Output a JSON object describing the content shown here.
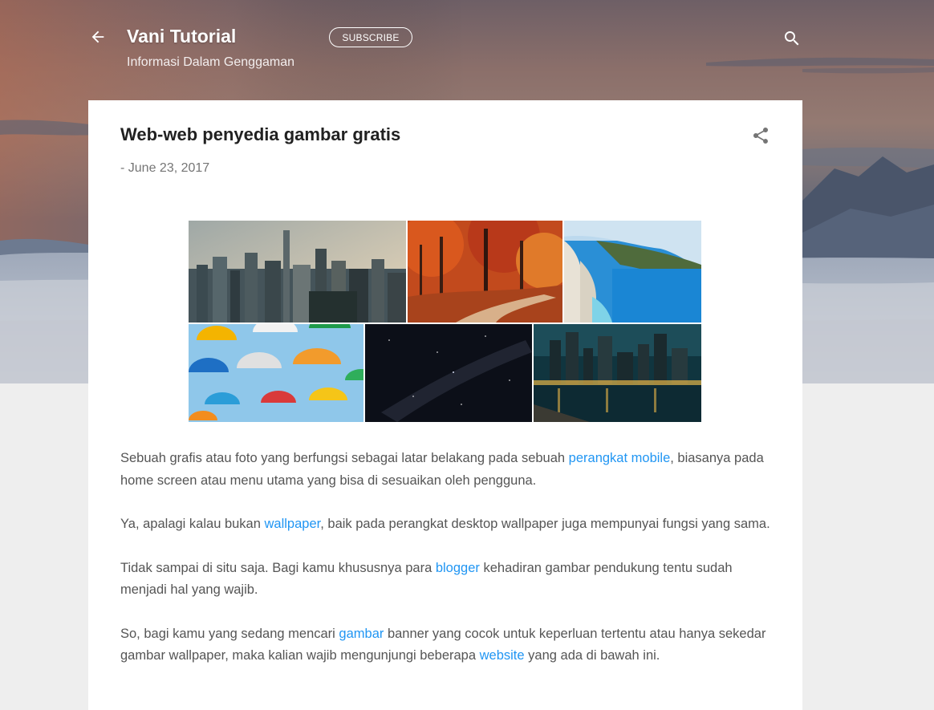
{
  "header": {
    "site_title": "Vani Tutorial",
    "site_description": "Informasi Dalam Genggaman",
    "subscribe_label": "SUBSCRIBE",
    "back_icon": "arrow-left-icon",
    "search_icon": "search-icon"
  },
  "post": {
    "title": "Web-web penyedia gambar gratis",
    "date": "- June 23, 2017",
    "share_icon": "share-icon",
    "paragraphs": [
      {
        "before": "Sebuah grafis atau foto yang berfungsi sebagai latar belakang pada sebuah ",
        "link": "perangkat mobile",
        "after": ", biasanya pada home screen atau menu utama yang bisa di sesuaikan oleh pengguna."
      },
      {
        "before": "Ya, apalagi kalau bukan ",
        "link": "wallpaper",
        "after": ", baik pada perangkat desktop wallpaper juga mempunyai fungsi yang sama."
      },
      {
        "before": "Tidak sampai di situ saja. Bagi kamu khususnya para ",
        "link": "blogger",
        "after": " kehadiran gambar pendukung tentu sudah menjadi hal yang wajib."
      },
      {
        "before": "So, bagi kamu yang sedang mencari ",
        "link": "gambar",
        "middle": " banner yang cocok untuk keperluan tertentu atau hanya sekedar gambar wallpaper, maka kalian wajib mengunjungi beberapa ",
        "link2": "website",
        "after": " yang ada di bawah ini."
      }
    ]
  },
  "colors": {
    "link": "#2196f3",
    "body_text": "#555555",
    "page_background": "#eeeeee"
  }
}
